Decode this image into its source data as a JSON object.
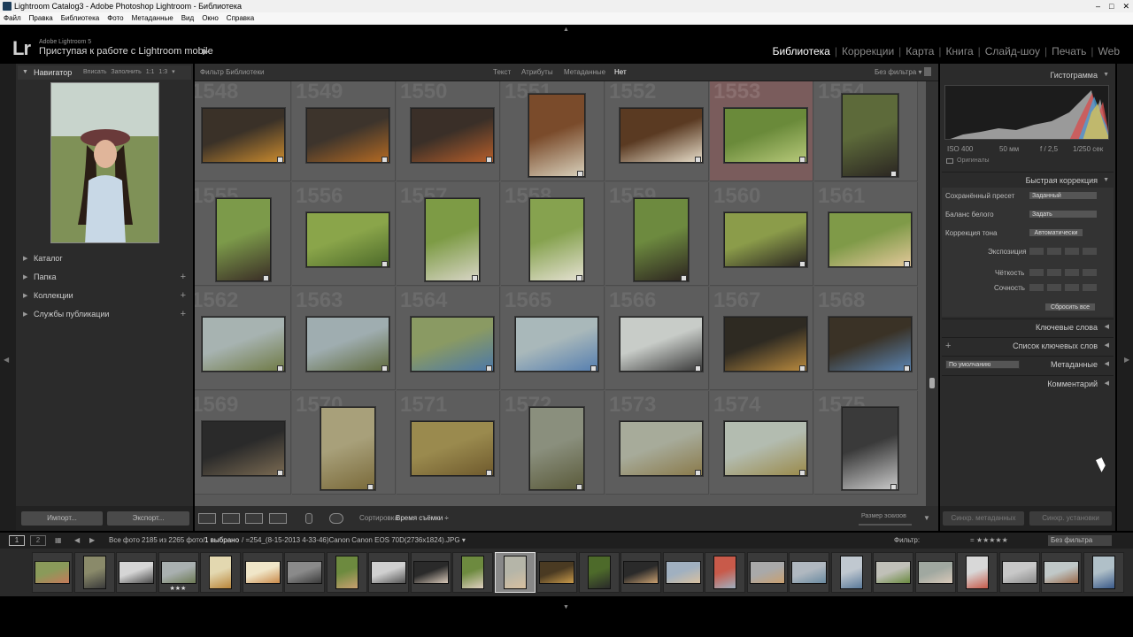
{
  "window": {
    "title": "Lightroom Catalog3 - Adobe Photoshop Lightroom - Библиотека",
    "controls": [
      "–",
      "□",
      "✕"
    ]
  },
  "menu": [
    "Файл",
    "Правка",
    "Библиотека",
    "Фото",
    "Метаданные",
    "Вид",
    "Окно",
    "Справка"
  ],
  "identity": {
    "logo": "Lr",
    "product": "Adobe Lightroom 5",
    "mobile_prompt": "Приступая к работе с Lightroom mobile",
    "arrow": "▶"
  },
  "modules": [
    {
      "label": "Библиотека",
      "active": true
    },
    {
      "label": "Коррекции",
      "active": false
    },
    {
      "label": "Карта",
      "active": false
    },
    {
      "label": "Книга",
      "active": false
    },
    {
      "label": "Слайд-шоу",
      "active": false
    },
    {
      "label": "Печать",
      "active": false
    },
    {
      "label": "Web",
      "active": false
    }
  ],
  "navigator": {
    "title": "Навигатор",
    "options": "Вписать Заполнить 1:1 1:3 ▾"
  },
  "left_sections": [
    {
      "label": "Каталог",
      "plus": false
    },
    {
      "label": "Папка",
      "plus": true
    },
    {
      "label": "Коллекции",
      "plus": true
    },
    {
      "label": "Службы публикации",
      "plus": true
    }
  ],
  "left_buttons": {
    "import": "Импорт...",
    "export": "Экспорт..."
  },
  "filter_bar": {
    "title": "Фильтр Библиотеки",
    "tabs": [
      "Текст",
      "Атрибуты",
      "Метаданные",
      "Нет"
    ],
    "active_tab": "Нет",
    "preset": "Без фильтра ▾"
  },
  "grid": {
    "cells": [
      {
        "num": "1548",
        "selected": false,
        "colors": [
          "#3a3128",
          "#c98a2e"
        ]
      },
      {
        "num": "1549",
        "selected": false,
        "colors": [
          "#3d342c",
          "#b46a23"
        ]
      },
      {
        "num": "1550",
        "selected": false,
        "colors": [
          "#3a2f28",
          "#b65e2a"
        ]
      },
      {
        "num": "1551",
        "selected": false,
        "colors": [
          "#7a4b2b",
          "#d8d0bb"
        ]
      },
      {
        "num": "1552",
        "selected": false,
        "colors": [
          "#5a3a22",
          "#e6dcc8"
        ]
      },
      {
        "num": "1553",
        "selected": true,
        "colors": [
          "#6a8a3a",
          "#b7c97a"
        ]
      },
      {
        "num": "1554",
        "selected": false,
        "colors": [
          "#5d6a3a",
          "#2b2622"
        ]
      },
      {
        "num": "1555",
        "selected": false,
        "colors": [
          "#7c9a4a",
          "#3a2d26"
        ]
      },
      {
        "num": "1556",
        "selected": false,
        "colors": [
          "#8aa54a",
          "#4d6a2a"
        ]
      },
      {
        "num": "1557",
        "selected": false,
        "colors": [
          "#7d9b45",
          "#d8d5c6"
        ]
      },
      {
        "num": "1558",
        "selected": false,
        "colors": [
          "#86a24f",
          "#e5e1d2"
        ]
      },
      {
        "num": "1559",
        "selected": false,
        "colors": [
          "#6d8a3f",
          "#2d2520"
        ]
      },
      {
        "num": "1560",
        "selected": false,
        "colors": [
          "#8b9c4a",
          "#2a2521"
        ]
      },
      {
        "num": "1561",
        "selected": false,
        "colors": [
          "#7f9a48",
          "#e3c89a"
        ]
      },
      {
        "num": "1562",
        "selected": false,
        "colors": [
          "#a7b3b1",
          "#6f7a45"
        ]
      },
      {
        "num": "1563",
        "selected": false,
        "colors": [
          "#9fadb0",
          "#5f6a3d"
        ]
      },
      {
        "num": "1564",
        "selected": false,
        "colors": [
          "#8a9a63",
          "#4c78a8"
        ]
      },
      {
        "num": "1565",
        "selected": false,
        "colors": [
          "#a9b8ba",
          "#567fb0"
        ]
      },
      {
        "num": "1566",
        "selected": false,
        "colors": [
          "#c8ccc8",
          "#3a3a3a"
        ]
      },
      {
        "num": "1567",
        "selected": false,
        "colors": [
          "#2e2a22",
          "#b98a3e"
        ]
      },
      {
        "num": "1568",
        "selected": false,
        "colors": [
          "#3a3226",
          "#5a84b2"
        ]
      },
      {
        "num": "1569",
        "selected": false,
        "colors": [
          "#2a2a2a",
          "#7a6a52"
        ]
      },
      {
        "num": "1570",
        "selected": false,
        "colors": [
          "#a8a07a",
          "#7a6a3a"
        ]
      },
      {
        "num": "1571",
        "selected": false,
        "colors": [
          "#9a8a4e",
          "#6f5a2d"
        ]
      },
      {
        "num": "1572",
        "selected": false,
        "colors": [
          "#8a8f7d",
          "#5a5a3a"
        ]
      },
      {
        "num": "1573",
        "selected": false,
        "colors": [
          "#a7ab9a",
          "#8a7a4a"
        ]
      },
      {
        "num": "1574",
        "selected": false,
        "colors": [
          "#b3bcb0",
          "#9a8a4a"
        ]
      },
      {
        "num": "1575",
        "selected": false,
        "colors": [
          "#3a3a3a",
          "#c9c9c9"
        ]
      }
    ]
  },
  "toolbar": {
    "sort_label": "Сортировка:",
    "sort_value": "Время съёмки ÷",
    "thumb_size": "Размер эскизов"
  },
  "right_panel": {
    "histogram_title": "Гистограмма",
    "exif": [
      "ISO 400",
      "50 мм",
      "f / 2,5",
      "1/250 сек"
    ],
    "originals": "Оригиналы",
    "quick_dev": {
      "title": "Быстрая коррекция",
      "saved_preset_label": "Сохранённый пресет",
      "saved_preset_value": "Заданный",
      "wb_label": "Баланс белого",
      "wb_value": "Задать",
      "tone_label": "Коррекция тона",
      "tone_value": "Автоматически",
      "exposure_label": "Экспозиция",
      "clarity_label": "Чёткость",
      "vibrance_label": "Сочность",
      "reset": "Сбросить все"
    },
    "keywording": "Ключевые слова",
    "keyword_list": "Список ключевых слов",
    "metadata_preset": "По умолчанию",
    "metadata": "Метаданные",
    "comments": "Комментарий",
    "sync_metadata": "Синхр. метаданных",
    "sync_settings": "Синхр. установки"
  },
  "filmstrip_header": {
    "page1": "1",
    "page2": "2",
    "source": "Все фото",
    "count": "2185 из 2265 фото/",
    "selected": "1 выбрано",
    "filename": "/ =254_(8-15-2013 4-33-46)Canon Canon EOS 70D(2736x1824).JPG ▾",
    "filter_label": "Фильтр:",
    "filter_value": "Без фильтра",
    "stars": "= ★★★★★"
  },
  "filmstrip": [
    {
      "colors": [
        "#8a9a5a",
        "#c57a5a"
      ]
    },
    {
      "colors": [
        "#8a8a6a",
        "#3a3a3a"
      ]
    },
    {
      "colors": [
        "#d5d5d5",
        "#4a4a4a"
      ]
    },
    {
      "colors": [
        "#a9b0b0",
        "#6d7a55"
      ],
      "stars": "★★★"
    },
    {
      "colors": [
        "#e3d8b0",
        "#b9863a"
      ]
    },
    {
      "colors": [
        "#f0e6c8",
        "#c98a4a"
      ]
    },
    {
      "colors": [
        "#8a8a8a",
        "#3a3a3a"
      ]
    },
    {
      "colors": [
        "#6d8a3f",
        "#c9a070"
      ]
    },
    {
      "colors": [
        "#d0d0d0",
        "#555555"
      ]
    },
    {
      "colors": [
        "#2a2a2a",
        "#d8c8b8"
      ]
    },
    {
      "colors": [
        "#6d8a3f",
        "#e0d0c0"
      ]
    },
    {
      "colors": [
        "#b5b5a8",
        "#d8c0a0"
      ],
      "selected": true
    },
    {
      "colors": [
        "#4a3a22",
        "#c99a4a"
      ]
    },
    {
      "colors": [
        "#4d6a2a",
        "#2a2a2a"
      ]
    },
    {
      "colors": [
        "#2a2a2a",
        "#c9a070"
      ]
    },
    {
      "colors": [
        "#a0b0c0",
        "#d8c0a0"
      ]
    },
    {
      "colors": [
        "#c85a4a",
        "#a0b0c0"
      ]
    },
    {
      "colors": [
        "#a9a9a9",
        "#c9a070"
      ]
    },
    {
      "colors": [
        "#b0b8c0",
        "#6a8aa0"
      ]
    },
    {
      "colors": [
        "#c0c8d0",
        "#5a7a9a"
      ]
    },
    {
      "colors": [
        "#c0c0b8",
        "#6a8a3f"
      ]
    },
    {
      "colors": [
        "#a0a8a0",
        "#d8c8b8"
      ]
    },
    {
      "colors": [
        "#d8d8d8",
        "#c85a4a"
      ]
    },
    {
      "colors": [
        "#c8c8c8",
        "#8a8a8a"
      ]
    },
    {
      "colors": [
        "#c0c8c8",
        "#9a6a4a"
      ]
    },
    {
      "colors": [
        "#b0c0c8",
        "#3a5a8a"
      ]
    }
  ]
}
